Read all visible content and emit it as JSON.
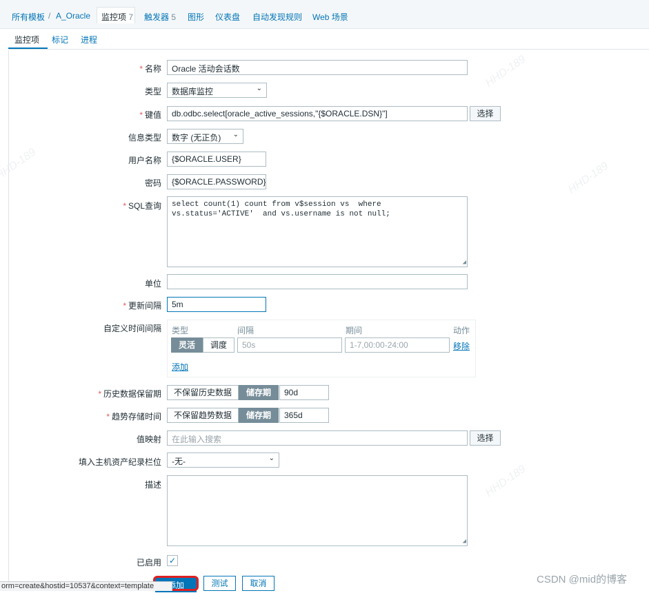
{
  "topnav": {
    "crumbs": [
      "所有模板",
      "A_Oracle"
    ],
    "separator": "/",
    "tabs": [
      {
        "label": "监控项",
        "count": "7"
      },
      {
        "label": "触发器",
        "count": "5"
      },
      {
        "label": "图形"
      },
      {
        "label": "仪表盘"
      },
      {
        "label": "自动发现规则"
      },
      {
        "label": "Web 场景"
      }
    ]
  },
  "subtabs": [
    "监控项",
    "标记",
    "进程"
  ],
  "form": {
    "name": {
      "label": "名称",
      "value": "Oracle 活动会话数"
    },
    "type": {
      "label": "类型",
      "value": "数据库监控"
    },
    "key": {
      "label": "键值",
      "value": "db.odbc.select[oracle_active_sessions,\"{$ORACLE.DSN}\"]",
      "button": "选择"
    },
    "info_type": {
      "label": "信息类型",
      "value": "数字 (无正负)"
    },
    "username": {
      "label": "用户名称",
      "value": "{$ORACLE.USER}"
    },
    "password": {
      "label": "密码",
      "value": "{$ORACLE.PASSWORD}"
    },
    "sql": {
      "label": "SQL查询",
      "value": "select count(1) count from v$session vs  where\nvs.status='ACTIVE'  and vs.username is not null;"
    },
    "units": {
      "label": "单位",
      "value": ""
    },
    "update_interval": {
      "label": "更新间隔",
      "value": "5m"
    },
    "custom_intervals": {
      "label": "自定义时间间隔",
      "headers": [
        "类型",
        "间隔",
        "期间",
        "动作"
      ],
      "type_options": [
        "灵活",
        "调度"
      ],
      "interval_placeholder": "50s",
      "period_placeholder": "1-7,00:00-24:00",
      "remove": "移除",
      "add": "添加"
    },
    "history": {
      "label": "历史数据保留期",
      "options": [
        "不保留历史数据",
        "储存期"
      ],
      "value": "90d"
    },
    "trends": {
      "label": "趋势存储时间",
      "options": [
        "不保留趋势数据",
        "储存期"
      ],
      "value": "365d"
    },
    "valuemap": {
      "label": "值映射",
      "placeholder": "在此输入搜索",
      "button": "选择"
    },
    "inventory": {
      "label": "填入主机资产纪录栏位",
      "value": "-无-"
    },
    "description": {
      "label": "描述",
      "value": ""
    },
    "enabled": {
      "label": "已启用",
      "checked": true,
      "mark": "✓"
    }
  },
  "actions": {
    "add": "添加",
    "test": "测试",
    "cancel": "取消"
  },
  "statusbar": "orm=create&hostid=10537&context=template",
  "watermark": "CSDN @mid的博客",
  "bg_watermark": "HHD-189",
  "colors": {
    "accent": "#0275b8",
    "required": "#e45959",
    "highlight": "#e02020",
    "segment_on": "#768d99"
  }
}
